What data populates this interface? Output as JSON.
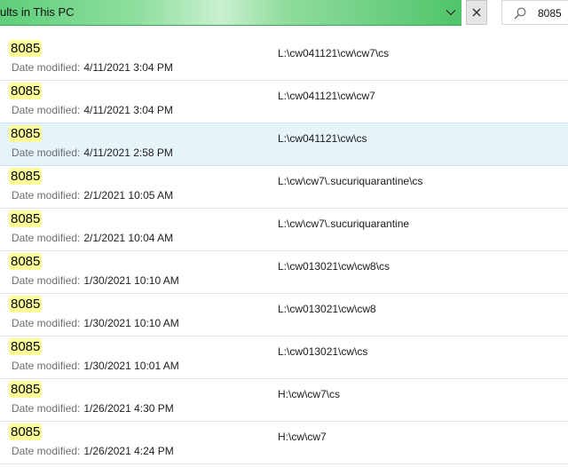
{
  "address_bar": {
    "text": "ults in This PC"
  },
  "search": {
    "query": "8085"
  },
  "icons": {
    "dropdown": "chevron-down-icon",
    "clear": "close-icon",
    "search": "search-icon"
  },
  "colors": {
    "address_bar_green": "#5fce7a",
    "highlight_yellow": "#ffff9a",
    "selected_row": "#e5f3fb"
  },
  "results": {
    "date_label": "Date modified:",
    "items": [
      {
        "name": "8085",
        "date": "4/11/2021 3:04 PM",
        "path": "L:\\cw041121\\cw\\cw7\\cs"
      },
      {
        "name": "8085",
        "date": "4/11/2021 3:04 PM",
        "path": "L:\\cw041121\\cw\\cw7"
      },
      {
        "name": "8085",
        "date": "4/11/2021 2:58 PM",
        "path": "L:\\cw041121\\cw\\cs",
        "selected": true
      },
      {
        "name": "8085",
        "date": "2/1/2021 10:05 AM",
        "path": "L:\\cw\\cw7\\.sucuriquarantine\\cs"
      },
      {
        "name": "8085",
        "date": "2/1/2021 10:04 AM",
        "path": "L:\\cw\\cw7\\.sucuriquarantine"
      },
      {
        "name": "8085",
        "date": "1/30/2021 10:10 AM",
        "path": "L:\\cw013021\\cw\\cw8\\cs"
      },
      {
        "name": "8085",
        "date": "1/30/2021 10:10 AM",
        "path": "L:\\cw013021\\cw\\cw8"
      },
      {
        "name": "8085",
        "date": "1/30/2021 10:01 AM",
        "path": "L:\\cw013021\\cw\\cs"
      },
      {
        "name": "8085",
        "date": "1/26/2021 4:30 PM",
        "path": "H:\\cw\\cw7\\cs"
      },
      {
        "name": "8085",
        "date": "1/26/2021 4:24 PM",
        "path": "H:\\cw\\cw7"
      }
    ]
  }
}
